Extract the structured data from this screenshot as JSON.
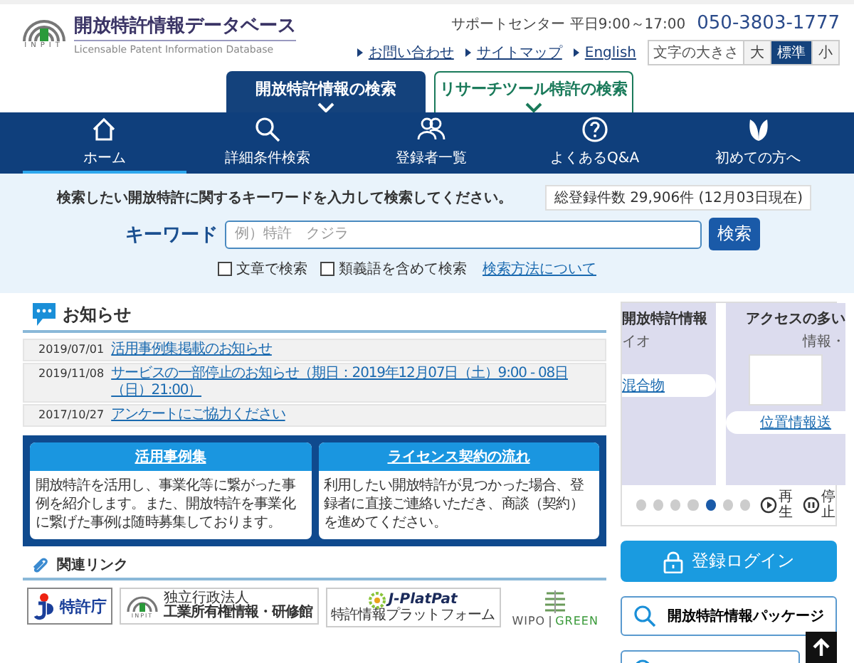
{
  "header": {
    "logo_mark": "INPIT",
    "title": "開放特許情報データベース",
    "subtitle": "Licensable Patent Information Database",
    "support_label": "サポートセンター 平日9:00～17:00",
    "phone": "050-3803-1777",
    "links": [
      "お問い合わせ",
      "サイトマップ",
      "English"
    ],
    "font_size": {
      "label": "文字の大きさ",
      "options": [
        {
          "label": "大",
          "selected": false
        },
        {
          "label": "標準",
          "selected": true
        },
        {
          "label": "小",
          "selected": false
        }
      ]
    }
  },
  "search_tabs": [
    {
      "label": "開放特許情報の検索",
      "selected": true
    },
    {
      "label": "リサーチツール特許の検索",
      "selected": false
    }
  ],
  "nav": [
    {
      "label": "ホーム",
      "selected": true
    },
    {
      "label": "詳細条件検索",
      "selected": false
    },
    {
      "label": "登録者一覧",
      "selected": false
    },
    {
      "label": "よくあるQ&A",
      "selected": false
    },
    {
      "label": "初めての方へ",
      "selected": false
    }
  ],
  "search": {
    "instruction": "検索したい開放特許に関するキーワードを入力して検索してください。",
    "total": "総登録件数 29,906件 (12月03日現在)",
    "label": "キーワード",
    "placeholder": "例）特許　クジラ",
    "button": "検索",
    "options": [
      {
        "label": "文章で検索",
        "checked": false
      },
      {
        "label": "類義語を含めて検索",
        "checked": false
      }
    ],
    "help_link": "検索方法について"
  },
  "news": {
    "title": "お知らせ",
    "items": [
      {
        "date": "2019/07/01",
        "text": "活用事例集掲載のお知らせ"
      },
      {
        "date": "2019/11/08",
        "text": "サービスの一部停止のお知らせ（期日：2019年12月07日（土）9:00 - 08日（日）21:00）"
      },
      {
        "date": "2017/10/27",
        "text": "アンケートにご協力ください"
      }
    ]
  },
  "features": [
    {
      "title": "活用事例集",
      "text": "開放特許を活用し、事業化等に繋がった事例を紹介します。また、開放特許を事業化に繋げた事例は随時募集しております。"
    },
    {
      "title": "ライセンス契約の流れ",
      "text": "利用したい開放特許が見つかった場合、登録者に直接ご連絡いただき、商談（契約）を進めてください。"
    }
  ],
  "related_links": {
    "title": "関連リンク",
    "logos": [
      {
        "kind": "jpo",
        "name": "特許庁"
      },
      {
        "kind": "inpit",
        "mark": "INPIT",
        "caption": "独立行政法人",
        "name": "工業所有権情報・研修館"
      },
      {
        "kind": "jplatpat",
        "name": "J-PlatPat",
        "caption": "特許情報プラットフォーム"
      },
      {
        "kind": "wipo",
        "name": "WIPO",
        "caption": "GREEN"
      }
    ]
  },
  "carousel": {
    "slides": [
      {
        "title": "開放特許情報",
        "subtitle": "イオ",
        "link": "混合物",
        "has_image": false
      },
      {
        "title": "アクセスの多い",
        "subtitle": "情報・",
        "link": "位置情報送",
        "has_image": true
      }
    ],
    "dots": [
      {
        "selected": false
      },
      {
        "selected": false
      },
      {
        "selected": false
      },
      {
        "selected": false
      },
      {
        "selected": true
      },
      {
        "selected": false
      },
      {
        "selected": false
      }
    ],
    "play": "再生",
    "stop": "停止"
  },
  "sidebar_buttons": [
    {
      "kind": "login",
      "label": "登録ログイン"
    },
    {
      "kind": "package",
      "label": "開放特許情報パッケージ"
    },
    {
      "kind": "package"
    }
  ]
}
